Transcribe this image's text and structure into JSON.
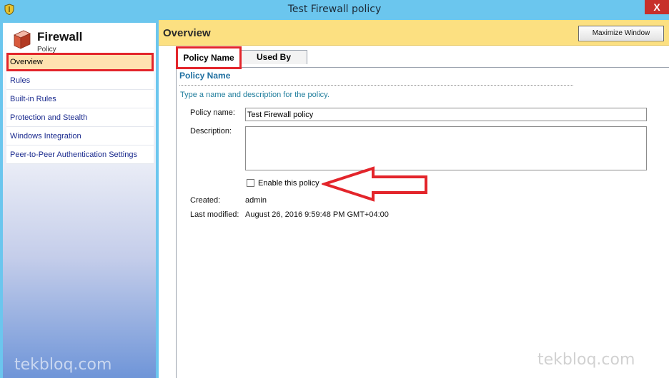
{
  "window": {
    "title": "Test Firewall policy",
    "close_glyph": "X"
  },
  "sidebar": {
    "title": "Firewall",
    "subtitle": "Policy",
    "items": [
      {
        "label": "Overview"
      },
      {
        "label": "Rules"
      },
      {
        "label": "Built-in Rules"
      },
      {
        "label": "Protection and Stealth"
      },
      {
        "label": "Windows Integration"
      },
      {
        "label": "Peer-to-Peer Authentication Settings"
      }
    ],
    "selected_index": 0
  },
  "main": {
    "header_title": "Overview",
    "maximize_label": "Maximize Window",
    "tabs": [
      {
        "label": "Policy Name",
        "active": true
      },
      {
        "label": "Used By",
        "active": false
      }
    ],
    "section_title": "Policy Name",
    "instructions": "Type a name and description for the policy.",
    "form": {
      "name_label": "Policy name:",
      "name_value": "Test Firewall policy",
      "description_label": "Description:",
      "description_value": "",
      "enable_label": "Enable this policy",
      "enable_checked": false,
      "created_label": "Created:",
      "created_value": "admin",
      "modified_label": "Last modified:",
      "modified_value": "August 26, 2016 9:59:48 PM GMT+04:00"
    }
  },
  "watermarks": {
    "left": "tekbloq.com",
    "right": "tekbloq.com"
  },
  "colors": {
    "title_bar": "#6bc6ee",
    "header_bar": "#fce081",
    "selected_item": "#ffe2b0",
    "annotation_red": "#e3252b",
    "section_title": "#1f6fa0"
  },
  "icons": {
    "app": "shield-icon",
    "sidebar": "firewall-brick-icon",
    "annotation": "red-arrow-icon"
  }
}
